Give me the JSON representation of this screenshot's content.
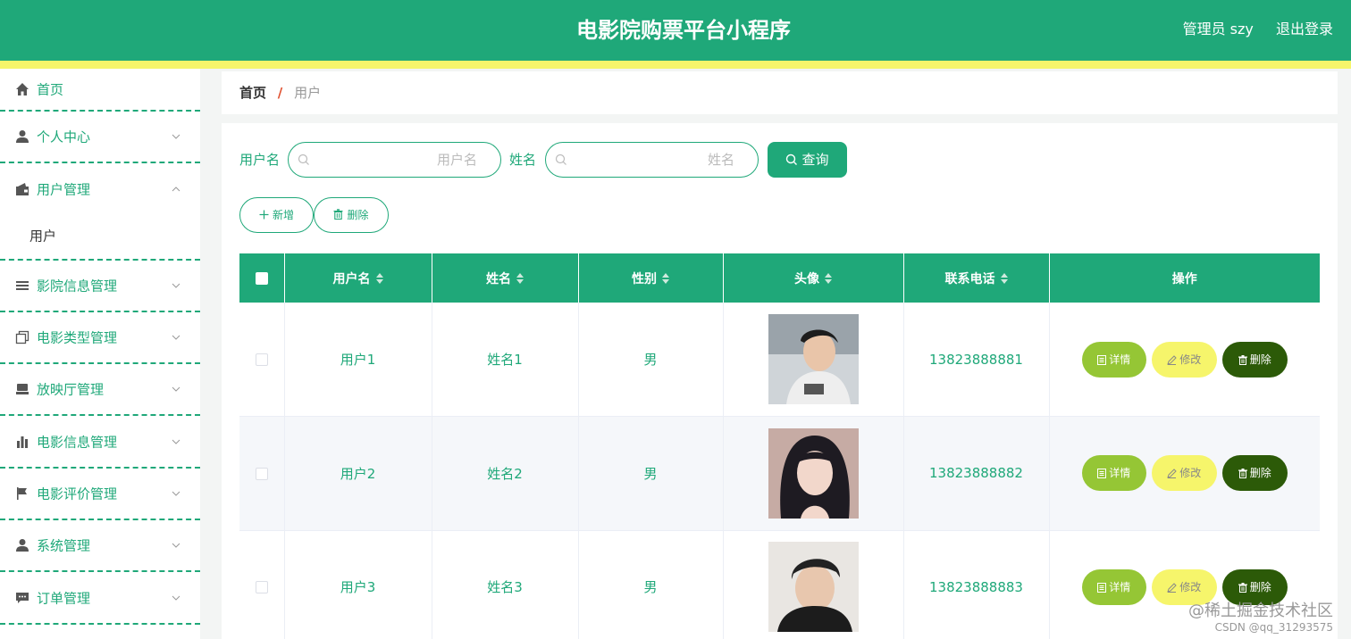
{
  "header": {
    "title": "电影院购票平台小程序",
    "admin": "管理员 szy",
    "logout": "退出登录"
  },
  "sidebar": {
    "items": [
      {
        "label": "首页",
        "icon": "home-icon"
      },
      {
        "label": "个人中心",
        "icon": "user-icon"
      },
      {
        "label": "用户管理",
        "icon": "wallet-icon"
      },
      {
        "label": "影院信息管理",
        "icon": "list-icon"
      },
      {
        "label": "电影类型管理",
        "icon": "copy-icon"
      },
      {
        "label": "放映厅管理",
        "icon": "box-icon"
      },
      {
        "label": "电影信息管理",
        "icon": "bar-chart-icon"
      },
      {
        "label": "电影评价管理",
        "icon": "flag-icon"
      },
      {
        "label": "系统管理",
        "icon": "user-icon"
      },
      {
        "label": "订单管理",
        "icon": "chat-icon"
      }
    ],
    "sub_item": "用户"
  },
  "breadcrumb": {
    "home": "首页",
    "sep": "/",
    "current": "用户"
  },
  "search": {
    "username_label": "用户名",
    "username_placeholder": "用户名",
    "name_label": "姓名",
    "name_placeholder": "姓名",
    "query": "查询"
  },
  "actions": {
    "add": "新增",
    "delete": "删除"
  },
  "table": {
    "headers": [
      "用户名",
      "姓名",
      "性别",
      "头像",
      "联系电话",
      "操作"
    ],
    "rows": [
      {
        "username": "用户1",
        "name": "姓名1",
        "gender": "男",
        "phone": "13823888881"
      },
      {
        "username": "用户2",
        "name": "姓名2",
        "gender": "男",
        "phone": "13823888882"
      },
      {
        "username": "用户3",
        "name": "姓名3",
        "gender": "男",
        "phone": "13823888883"
      }
    ],
    "ops": {
      "detail": "详情",
      "edit": "修改",
      "delete": "删除"
    }
  },
  "watermark": {
    "line1": "@稀土掘金技术社区",
    "line2": "CSDN @qq_31293575"
  },
  "colors": {
    "primary": "#1fa879",
    "stripe": "#f6f56b",
    "detail": "#95c635",
    "edit": "#f6f56b",
    "delete": "#2c5a08"
  }
}
